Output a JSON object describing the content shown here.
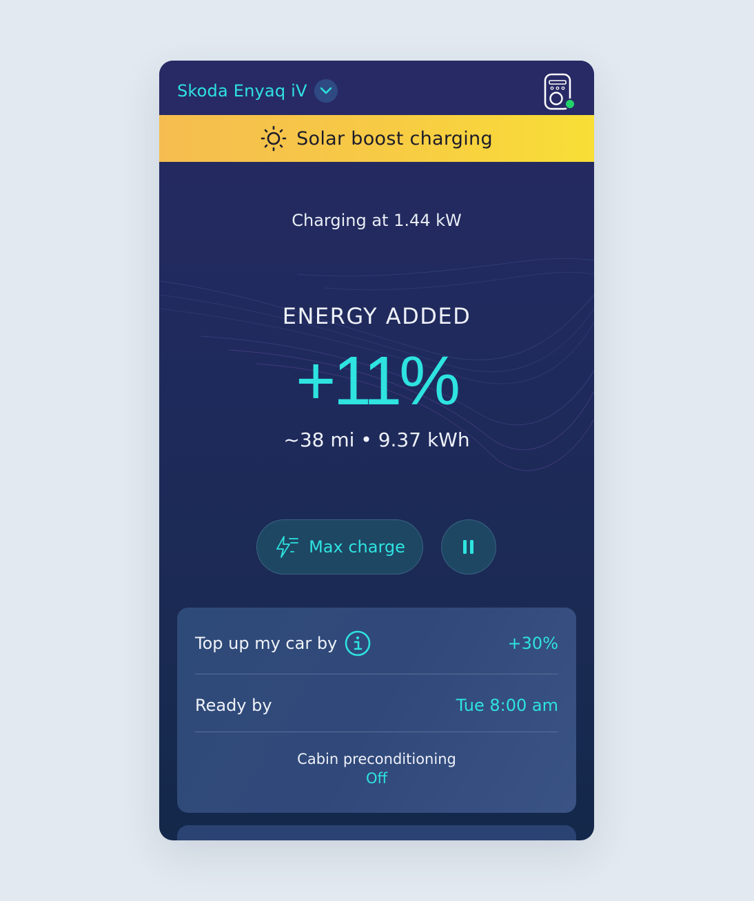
{
  "header": {
    "car_name": "Skoda Enyaq iV",
    "charger_status_color": "#22d36a"
  },
  "banner": {
    "text": "Solar boost charging",
    "color": "#f7ca45"
  },
  "charging": {
    "rate_text": "Charging at 1.44 kW",
    "energy_label": "ENERGY ADDED",
    "energy_value": "+11%",
    "energy_detail": "~38 mi • 9.37 kWh"
  },
  "controls": {
    "max_charge_label": "Max charge",
    "max_charge_icon": "bolt-lines-icon",
    "pause_icon": "pause-icon"
  },
  "settings": {
    "top_up_label": "Top up my car by",
    "top_up_value": "+30%",
    "ready_by_label": "Ready by",
    "ready_by_value": "Tue 8:00 am",
    "cabin_label": "Cabin preconditioning",
    "cabin_value": "Off"
  },
  "colors": {
    "accent": "#2ee3e0",
    "background": "#e2e9f0"
  }
}
